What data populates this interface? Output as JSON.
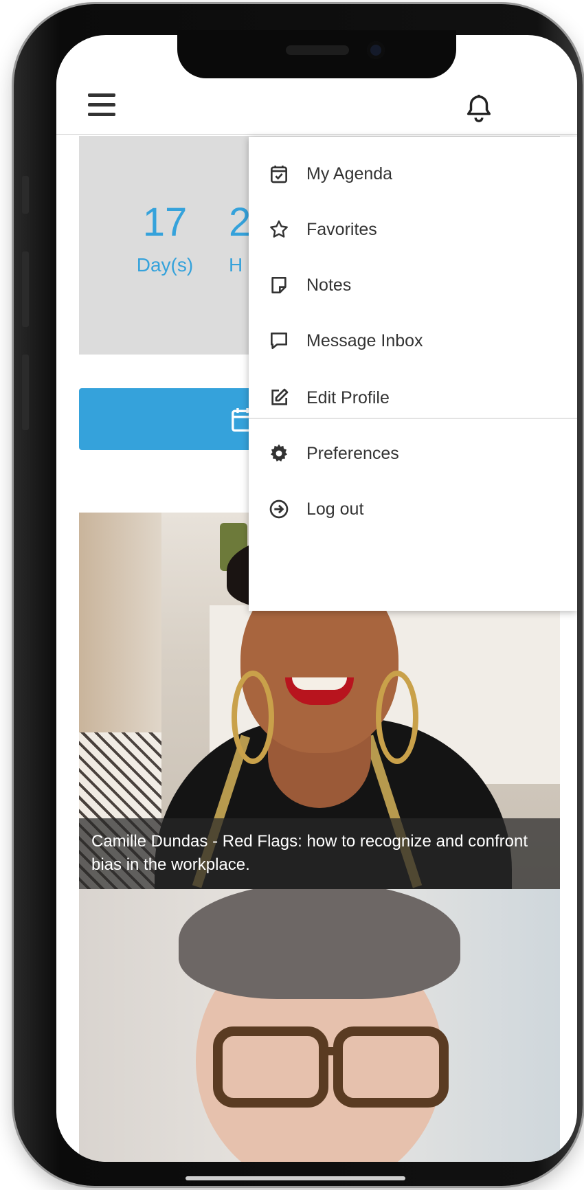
{
  "header": {
    "menu_icon": "hamburger-icon",
    "notification_icon": "bell-icon",
    "avatar_icon": "user-avatar"
  },
  "countdown": {
    "days_value": "17",
    "days_label": "Day(s)",
    "hours_value_partial": "2",
    "hours_label_partial": "H"
  },
  "action_button": {
    "icon": "calendar-icon"
  },
  "dropdown": {
    "items": [
      {
        "label": "My Agenda",
        "icon": "calendar-check-icon"
      },
      {
        "label": "Favorites",
        "icon": "star-icon"
      },
      {
        "label": "Notes",
        "icon": "sticky-note-icon"
      },
      {
        "label": "Message Inbox",
        "icon": "chat-bubble-icon"
      },
      {
        "label": "Edit Profile",
        "icon": "edit-icon"
      },
      {
        "label": "Preferences",
        "icon": "gear-icon"
      },
      {
        "label": "Log out",
        "icon": "logout-icon"
      }
    ]
  },
  "sessions": [
    {
      "caption": "Camille Dundas - Red Flags: how to recognize and confront bias in the workplace."
    },
    {
      "caption": ""
    }
  ],
  "colors": {
    "accent": "#35a2db",
    "countdown_bg": "#dcdcdc",
    "menu_text": "#333333"
  }
}
